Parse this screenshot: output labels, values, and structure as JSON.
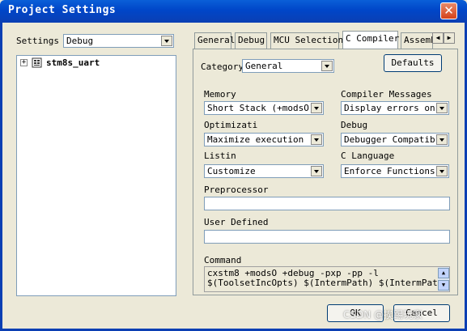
{
  "window": {
    "title": "Project Settings",
    "close_label": "✕"
  },
  "settings": {
    "label": "Settings",
    "value": "Debug"
  },
  "tree": {
    "items": [
      {
        "label": "stm8s_uart",
        "expander": "+"
      }
    ]
  },
  "tabs": [
    {
      "label": "General",
      "active": false
    },
    {
      "label": "Debug",
      "active": false
    },
    {
      "label": "MCU Selection",
      "active": false
    },
    {
      "label": "C Compiler",
      "active": true
    },
    {
      "label": "Assemb",
      "active": false
    }
  ],
  "panel": {
    "category": {
      "label": "Category",
      "value": "General"
    },
    "defaults_button": "Defaults",
    "memory": {
      "label": "Memory",
      "value": "Short Stack (+modsO)"
    },
    "compiler_messages": {
      "label": "Compiler Messages",
      "value": "Display errors only"
    },
    "optimizations": {
      "label": "Optimizati",
      "value": "Maximize execution spe"
    },
    "debug": {
      "label": "Debug",
      "value": "Debugger Compatible"
    },
    "listing": {
      "label": "Listin",
      "value": "Customize"
    },
    "c_language": {
      "label": "C Language",
      "value": "Enforce Functions Pr"
    },
    "preprocessor": {
      "label": "Preprocessor",
      "value": ""
    },
    "user_defined": {
      "label": "User Defined",
      "value": ""
    },
    "command": {
      "label": "Command",
      "line1": "cxstm8 +modsO +debug -pxp -pp -l",
      "line2": "$(ToolsetIncOpts) $(IntermPath) $(IntermPath)"
    }
  },
  "buttons": {
    "ok": "OK",
    "cancel": "Cancel"
  },
  "watermark": "CSDN @挨踢玩家"
}
